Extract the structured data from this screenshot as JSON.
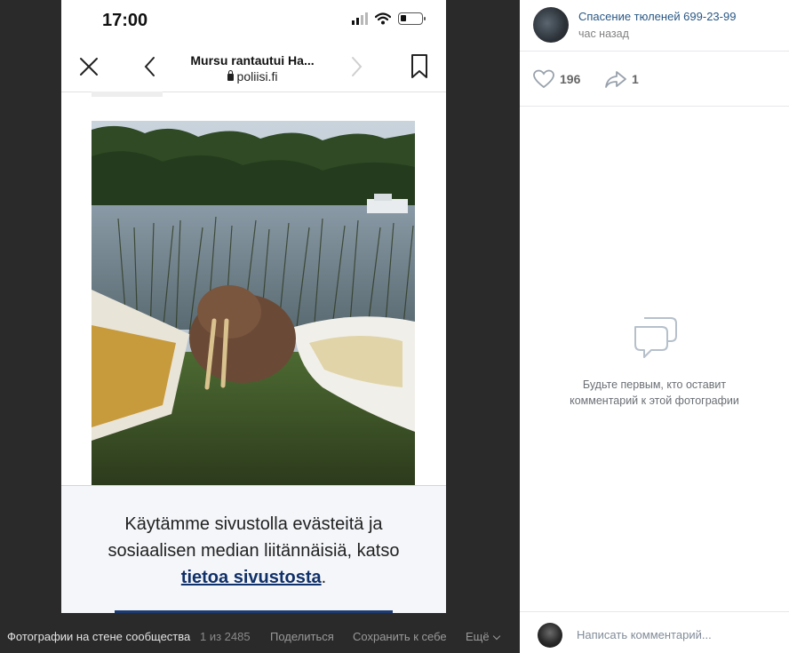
{
  "phone": {
    "status_time": "17:00",
    "browser_title": "Mursu rantautui Ha...",
    "browser_url": "poliisi.fi",
    "cookie_text": "Käytämme sivustolla evästeitä ja sosiaalisen median liitännäisiä, katso",
    "cookie_link": "tietoa sivustosta",
    "cookie_end": "."
  },
  "viewer_bar": {
    "album": "Фотографии на стене сообщества",
    "count": "1 из 2485",
    "share": "Поделиться",
    "save": "Сохранить к себе",
    "more": "Ещё"
  },
  "post": {
    "author": "Спасение тюленей 699-23-99",
    "time": "час назад",
    "likes": "196",
    "shares": "1"
  },
  "comments": {
    "empty_text": "Будьте первым, кто оставит комментарий к этой фотографии",
    "placeholder": "Написать комментарий..."
  },
  "colors": {
    "link": "#2a5885",
    "cookie_link": "#10306a"
  }
}
